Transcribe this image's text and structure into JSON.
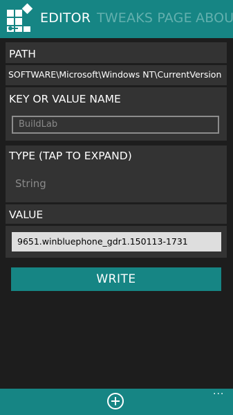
{
  "header": {
    "tabs": [
      {
        "label": "EDITOR",
        "active": true
      },
      {
        "label": "TWEAKS PAGE",
        "active": false
      },
      {
        "label": "ABOU",
        "active": false
      }
    ],
    "logo_icon": "registry-tool-logo-icon"
  },
  "path": {
    "title": "PATH",
    "value": "SOFTWARE\\Microsoft\\Windows NT\\CurrentVersion"
  },
  "key": {
    "title": "KEY OR VALUE NAME",
    "input_value": "BuildLab"
  },
  "type": {
    "title": "TYPE (TAP TO EXPAND)",
    "selected": "String"
  },
  "value": {
    "title": "VALUE",
    "input_value": "9651.winbluephone_gdr1.150113-1731"
  },
  "actions": {
    "write_label": "WRITE"
  },
  "appbar": {
    "add_icon": "add-circle-icon",
    "more_label": "..."
  },
  "colors": {
    "accent": "#168584",
    "inactive_tab": "#63b0ae",
    "panel": "#333333",
    "background": "#1d1d1d"
  }
}
